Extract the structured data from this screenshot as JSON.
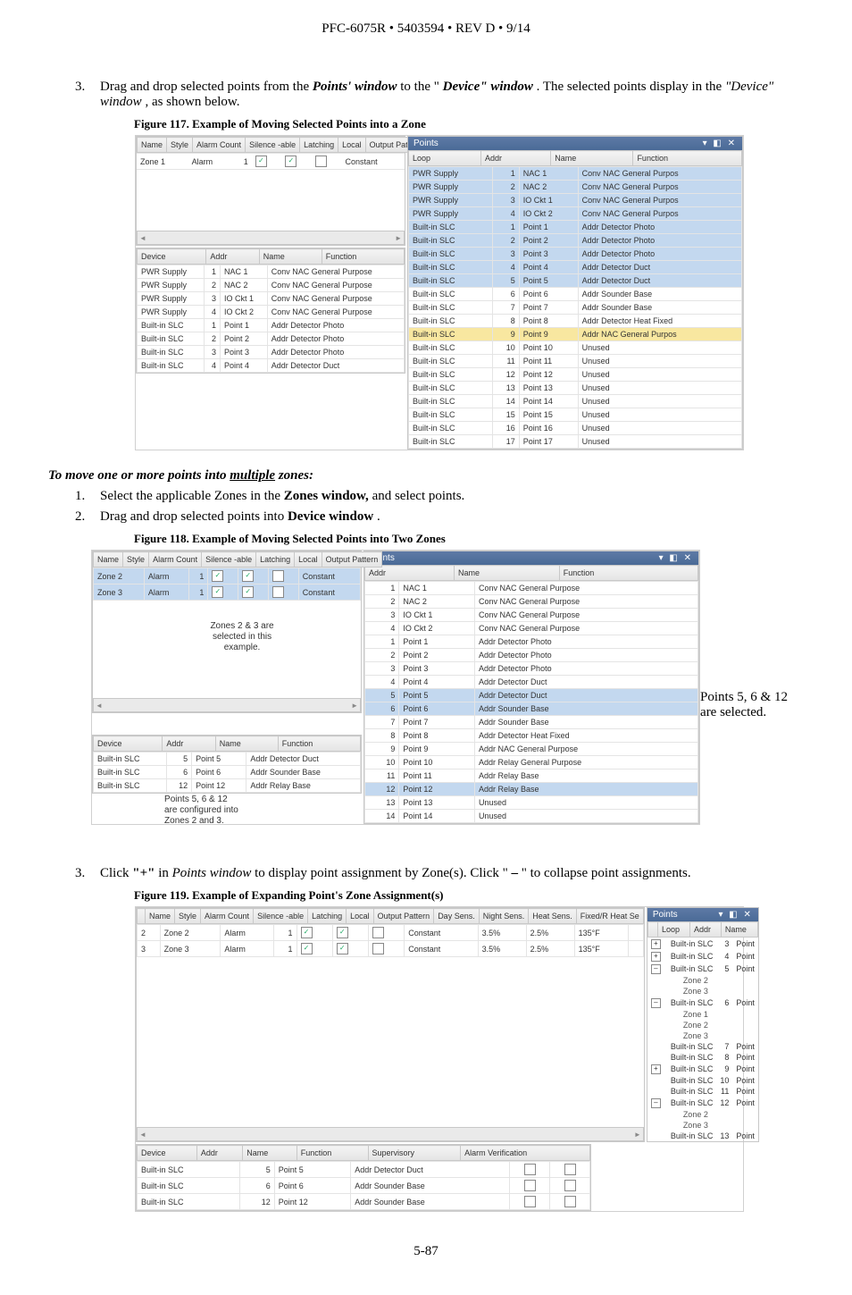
{
  "header": "PFC-6075R • 5403594 • REV D • 9/14",
  "step1": {
    "num": "3.",
    "a": "Drag and drop selected points from the ",
    "b": "Points' window",
    "c": " to the \"",
    "d": "Device\" window",
    "e": ". The selected points display in the ",
    "f": "\"Device\" window",
    "g": ", as shown below."
  },
  "fig117cap": "Figure 117. Example of Moving Selected Points into a Zone",
  "subhead": {
    "a": "To move one or more points into ",
    "b": "multiple",
    "c": " zones:"
  },
  "step2": {
    "num": "1.",
    "a": "Select the applicable Zones in the ",
    "b": "Zones window,",
    "c": " and select points."
  },
  "step3": {
    "num": "2.",
    "a": "Drag and drop selected points into ",
    "b": "Device window",
    "c": "."
  },
  "fig118cap": "Figure 118. Example of Moving Selected Points into Two Zones",
  "step4": {
    "num": "3.",
    "a": "Click ",
    "b": "\"+\"",
    "c": " in ",
    "d": "Points window",
    "e": " to display point assignment by Zone(s). Click \"",
    "f": "–",
    "g": "\" to collapse point assignments."
  },
  "fig119cap": "Figure 119. Example of Expanding Point's Zone Assignment(s)",
  "footer": "5-87",
  "cols": {
    "zone": [
      "Name",
      "Style",
      "Alarm Count",
      "Silence -able",
      "Latching",
      "Local",
      "Output Pattern"
    ],
    "device": [
      "Device",
      "Addr",
      "Name",
      "Function"
    ],
    "points": [
      "Loop",
      "Addr",
      "Name",
      "Function"
    ],
    "pointsB": [
      "Addr",
      "Name",
      "Function"
    ],
    "zone119": [
      "",
      "Name",
      "Style",
      "Alarm Count",
      "Silence -able",
      "Latching",
      "Local",
      "Output Pattern",
      "Day Sens.",
      "Night Sens.",
      "Heat Sens.",
      "Fixed/R Heat Se"
    ],
    "dev119": [
      "Device",
      "Addr",
      "Name",
      "Function",
      "Supervisory",
      "Alarm Verification"
    ],
    "pts119": [
      "",
      "Loop",
      "Addr",
      "Name"
    ]
  },
  "f117": {
    "zone": {
      "name": "Zone 1",
      "style": "Alarm",
      "count": "1",
      "pattern": "Constant"
    },
    "device": [
      [
        "PWR Supply",
        "1",
        "NAC 1",
        "Conv NAC General Purpose"
      ],
      [
        "PWR Supply",
        "2",
        "NAC 2",
        "Conv NAC General Purpose"
      ],
      [
        "PWR Supply",
        "3",
        "IO Ckt 1",
        "Conv NAC General Purpose"
      ],
      [
        "PWR Supply",
        "4",
        "IO Ckt 2",
        "Conv NAC General Purpose"
      ],
      [
        "Built-in SLC",
        "1",
        "Point 1",
        "Addr Detector Photo"
      ],
      [
        "Built-in SLC",
        "2",
        "Point 2",
        "Addr Detector Photo"
      ],
      [
        "Built-in SLC",
        "3",
        "Point 3",
        "Addr Detector Photo"
      ],
      [
        "Built-in SLC",
        "4",
        "Point 4",
        "Addr Detector Duct"
      ]
    ],
    "points": [
      [
        "PWR Supply",
        "1",
        "NAC 1",
        "Conv NAC General Purpos"
      ],
      [
        "PWR Supply",
        "2",
        "NAC 2",
        "Conv NAC General Purpos"
      ],
      [
        "PWR Supply",
        "3",
        "IO Ckt 1",
        "Conv NAC General Purpos"
      ],
      [
        "PWR Supply",
        "4",
        "IO Ckt 2",
        "Conv NAC General Purpos"
      ],
      [
        "Built-in SLC",
        "1",
        "Point 1",
        "Addr Detector Photo"
      ],
      [
        "Built-in SLC",
        "2",
        "Point 2",
        "Addr Detector Photo"
      ],
      [
        "Built-in SLC",
        "3",
        "Point 3",
        "Addr Detector Photo"
      ],
      [
        "Built-in SLC",
        "4",
        "Point 4",
        "Addr Detector Duct"
      ],
      [
        "Built-in SLC",
        "5",
        "Point 5",
        "Addr Detector Duct"
      ],
      [
        "Built-in SLC",
        "6",
        "Point 6",
        "Addr Sounder Base"
      ],
      [
        "Built-in SLC",
        "7",
        "Point 7",
        "Addr Sounder Base"
      ],
      [
        "Built-in SLC",
        "8",
        "Point 8",
        "Addr Detector Heat Fixed"
      ],
      [
        "Built-in SLC",
        "9",
        "Point 9",
        "Addr NAC General Purpos"
      ],
      [
        "Built-in SLC",
        "10",
        "Point 10",
        "Unused"
      ],
      [
        "Built-in SLC",
        "11",
        "Point 11",
        "Unused"
      ],
      [
        "Built-in SLC",
        "12",
        "Point 12",
        "Unused"
      ],
      [
        "Built-in SLC",
        "13",
        "Point 13",
        "Unused"
      ],
      [
        "Built-in SLC",
        "14",
        "Point 14",
        "Unused"
      ],
      [
        "Built-in SLC",
        "15",
        "Point 15",
        "Unused"
      ],
      [
        "Built-in SLC",
        "16",
        "Point 16",
        "Unused"
      ],
      [
        "Built-in SLC",
        "17",
        "Point 17",
        "Unused"
      ]
    ]
  },
  "f118": {
    "zones": [
      {
        "name": "Zone 2",
        "style": "Alarm",
        "count": "1",
        "pattern": "Constant"
      },
      {
        "name": "Zone 3",
        "style": "Alarm",
        "count": "1",
        "pattern": "Constant"
      }
    ],
    "annot1": [
      "Zones 2 & 3 are",
      "selected in this",
      "example."
    ],
    "device": [
      [
        "Built-in SLC",
        "5",
        "Point 5",
        "Addr Detector Duct"
      ],
      [
        "Built-in SLC",
        "6",
        "Point 6",
        "Addr Sounder Base"
      ],
      [
        "Built-in SLC",
        "12",
        "Point 12",
        "Addr Relay Base"
      ]
    ],
    "annot2": [
      "Points 5, 6 & 12",
      "are configured into",
      "Zones 2 and 3."
    ],
    "points": [
      [
        "1",
        "NAC 1",
        "Conv NAC General Purpose"
      ],
      [
        "2",
        "NAC 2",
        "Conv NAC General Purpose"
      ],
      [
        "3",
        "IO Ckt 1",
        "Conv NAC General Purpose"
      ],
      [
        "4",
        "IO Ckt 2",
        "Conv NAC General Purpose"
      ],
      [
        "1",
        "Point 1",
        "Addr Detector Photo"
      ],
      [
        "2",
        "Point 2",
        "Addr Detector Photo"
      ],
      [
        "3",
        "Point 3",
        "Addr Detector Photo"
      ],
      [
        "4",
        "Point 4",
        "Addr Detector Duct"
      ],
      [
        "5",
        "Point 5",
        "Addr Detector Duct"
      ],
      [
        "6",
        "Point 6",
        "Addr Sounder Base"
      ],
      [
        "7",
        "Point 7",
        "Addr Sounder Base"
      ],
      [
        "8",
        "Point 8",
        "Addr Detector Heat Fixed"
      ],
      [
        "9",
        "Point 9",
        "Addr NAC General Purpose"
      ],
      [
        "10",
        "Point 10",
        "Addr Relay General Purpose"
      ],
      [
        "11",
        "Point 11",
        "Addr Relay Base"
      ],
      [
        "12",
        "Point 12",
        "Addr Relay Base"
      ],
      [
        "13",
        "Point 13",
        "Unused"
      ],
      [
        "14",
        "Point 14",
        "Unused"
      ]
    ],
    "callout": [
      "Points 5, 6 & 12",
      "are selected."
    ]
  },
  "f119": {
    "zones": [
      [
        "2",
        "Zone 2",
        "Alarm",
        "1",
        "",
        "",
        "",
        "Constant",
        "3.5%",
        "2.5%",
        "135°F",
        ""
      ],
      [
        "3",
        "Zone 3",
        "Alarm",
        "1",
        "",
        "",
        "",
        "Constant",
        "3.5%",
        "2.5%",
        "135°F",
        ""
      ]
    ],
    "device": [
      [
        "Built-in SLC",
        "5",
        "Point 5",
        "Addr Detector Duct"
      ],
      [
        "Built-in SLC",
        "6",
        "Point 6",
        "Addr Sounder Base"
      ],
      [
        "Built-in SLC",
        "12",
        "Point 12",
        "Addr Sounder Base"
      ]
    ],
    "tree": [
      {
        "e": "+",
        "l": "Built-in SLC",
        "a": "3",
        "n": "Point"
      },
      {
        "e": "+",
        "l": "Built-in SLC",
        "a": "4",
        "n": "Point"
      },
      {
        "e": "–",
        "l": "Built-in SLC",
        "a": "5",
        "n": "Point"
      },
      {
        "z": "Zone 2"
      },
      {
        "z": "Zone 3"
      },
      {
        "e": "–",
        "l": "Built-in SLC",
        "a": "6",
        "n": "Point"
      },
      {
        "z": "Zone 1"
      },
      {
        "z": "Zone 2"
      },
      {
        "z": "Zone 3"
      },
      {
        "e": "",
        "l": "Built-in SLC",
        "a": "7",
        "n": "Point"
      },
      {
        "e": "",
        "l": "Built-in SLC",
        "a": "8",
        "n": "Point"
      },
      {
        "e": "+",
        "l": "Built-in SLC",
        "a": "9",
        "n": "Point"
      },
      {
        "e": "",
        "l": "Built-in SLC",
        "a": "10",
        "n": "Point"
      },
      {
        "e": "",
        "l": "Built-in SLC",
        "a": "11",
        "n": "Point"
      },
      {
        "e": "–",
        "l": "Built-in SLC",
        "a": "12",
        "n": "Point"
      },
      {
        "z": "Zone 2"
      },
      {
        "z": "Zone 3"
      },
      {
        "e": "",
        "l": "Built-in SLC",
        "a": "13",
        "n": "Point"
      }
    ]
  },
  "ui": {
    "pointsTitle": "Points",
    "winbtns": "▾ ◧ ✕"
  }
}
